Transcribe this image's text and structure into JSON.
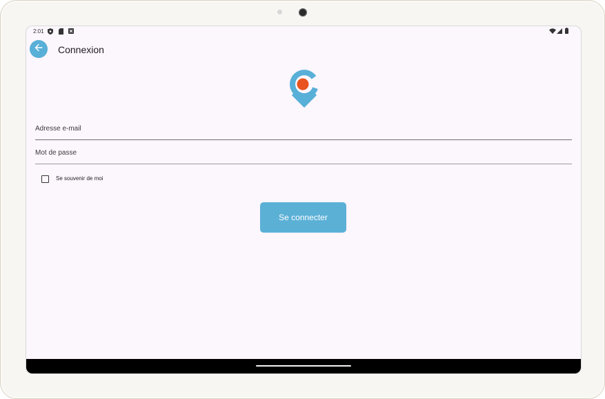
{
  "status_bar": {
    "time": "2:01",
    "icons": [
      "shield-icon",
      "sim-card-icon",
      "notification-icon",
      "wifi-icon",
      "signal-icon",
      "battery-icon"
    ]
  },
  "app_bar": {
    "back_icon": "arrow-back-icon",
    "title": "Connexion"
  },
  "logo": {
    "name": "location-pin-logo",
    "colors": {
      "ring": "#58afd7",
      "dot": "#e8531f"
    }
  },
  "form": {
    "email": {
      "label": "Adresse e-mail",
      "value": ""
    },
    "password": {
      "label": "Mot de passe",
      "value": ""
    },
    "remember_me": {
      "label": "Se souvenir de moi",
      "checked": false
    },
    "submit_label": "Se connecter"
  },
  "colors": {
    "accent": "#58afd7",
    "background": "#fcf6fd",
    "navbar": "#000000"
  }
}
